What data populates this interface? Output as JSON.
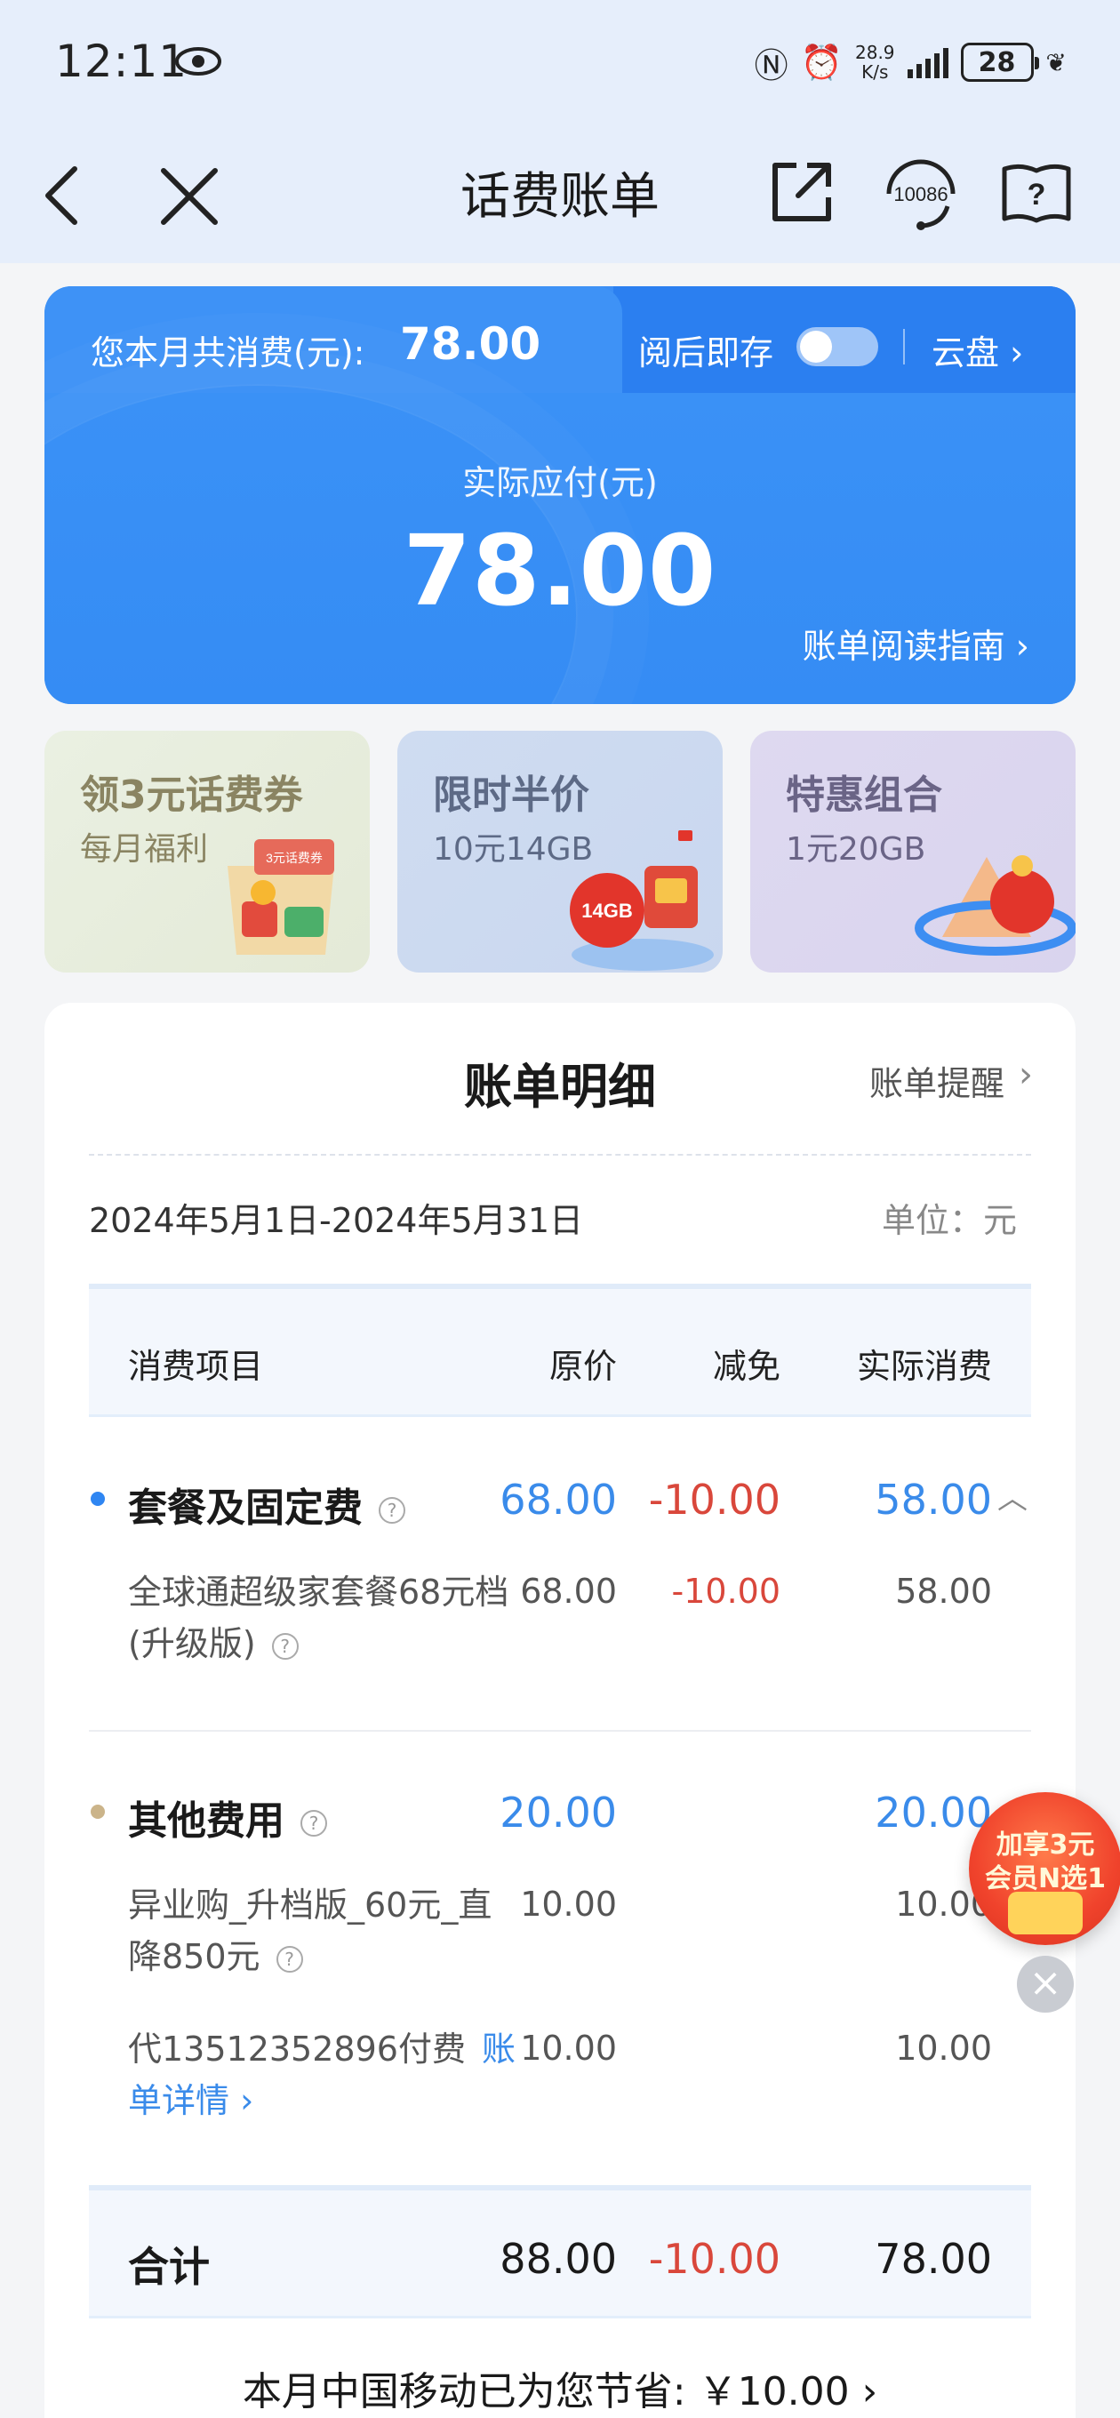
{
  "status_bar": {
    "time": "12:11",
    "net_speed_value": "28.9",
    "net_speed_unit": "K/s",
    "battery": "28"
  },
  "nav": {
    "title": "话费账单",
    "service_number": "10086"
  },
  "summary": {
    "monthly_label": "您本月共消费(元):",
    "monthly_value": "78.00",
    "read_and_save": "阅后即存",
    "read_and_save_on": false,
    "cloud_label": "云盘 ›",
    "actual_label": "实际应付(元)",
    "actual_value": "78.00",
    "guide_link": "账单阅读指南 ›"
  },
  "promos": [
    {
      "title": "领3元话费券",
      "subtitle": "每月福利",
      "art_text": "3元话费券"
    },
    {
      "title": "限时半价",
      "subtitle": "10元14GB",
      "art_text": "14GB"
    },
    {
      "title": "特惠组合",
      "subtitle": "1元20GB"
    }
  ],
  "detail": {
    "title": "账单明细",
    "remind": "账单提醒",
    "period": "2024年5月1日-2024年5月31日",
    "unit": "单位：元",
    "columns": [
      "消费项目",
      "原价",
      "减免",
      "实际消费"
    ],
    "categories": [
      {
        "name": "套餐及固定费",
        "original": "68.00",
        "discount": "-10.00",
        "actual": "58.00",
        "dot_color": "#2f86f2",
        "items": [
          {
            "name": "全球通超级家套餐68元档(升级版)",
            "original": "68.00",
            "discount": "-10.00",
            "actual": "58.00"
          }
        ]
      },
      {
        "name": "其他费用",
        "original": "20.00",
        "discount": "",
        "actual": "20.00",
        "dot_color": "#cbb48a",
        "items": [
          {
            "name": "异业购_升档版_60元_直降850元",
            "original": "10.00",
            "discount": "",
            "actual": "10.00"
          },
          {
            "name": "代13512352896付费",
            "link": "账单详情 ›",
            "original": "10.00",
            "discount": "",
            "actual": "10.00"
          }
        ]
      }
    ],
    "total": {
      "label": "合计",
      "original": "88.00",
      "discount": "-10.00",
      "actual": "78.00"
    },
    "saved_text": "本月中国移动已为您节省: ￥10.00 ›"
  },
  "float_badge": {
    "line1": "加享3元",
    "line2": "会员N选1"
  },
  "colors": {
    "accent_blue": "#3a8bea",
    "discount_red": "#d9473b",
    "card_blue": "#3a91f6"
  }
}
